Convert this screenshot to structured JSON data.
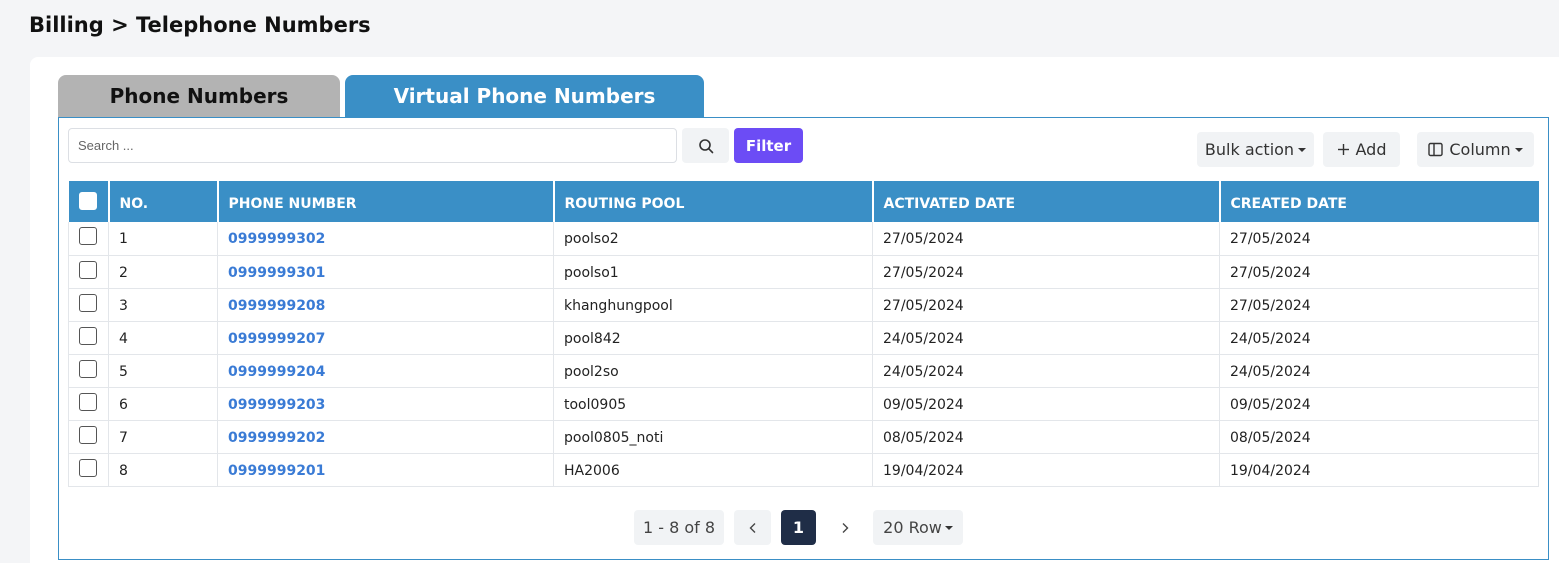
{
  "breadcrumb": "Billing > Telephone Numbers",
  "tabs": [
    {
      "label": "Phone Numbers",
      "active": false
    },
    {
      "label": "Virtual Phone Numbers",
      "active": true
    }
  ],
  "search": {
    "placeholder": "Search ...",
    "value": ""
  },
  "toolbar": {
    "filter_label": "Filter",
    "bulk_label": "Bulk action",
    "add_label": "Add",
    "column_label": "Column"
  },
  "table": {
    "headers": [
      "NO.",
      "PHONE NUMBER",
      "ROUTING POOL",
      "ACTIVATED DATE",
      "CREATED DATE"
    ],
    "rows": [
      {
        "no": "1",
        "phone": "0999999302",
        "pool": "poolso2",
        "activated": "27/05/2024",
        "created": "27/05/2024"
      },
      {
        "no": "2",
        "phone": "0999999301",
        "pool": "poolso1",
        "activated": "27/05/2024",
        "created": "27/05/2024"
      },
      {
        "no": "3",
        "phone": "0999999208",
        "pool": "khanghungpool",
        "activated": "27/05/2024",
        "created": "27/05/2024"
      },
      {
        "no": "4",
        "phone": "0999999207",
        "pool": "pool842",
        "activated": "24/05/2024",
        "created": "24/05/2024"
      },
      {
        "no": "5",
        "phone": "0999999204",
        "pool": "pool2so",
        "activated": "24/05/2024",
        "created": "24/05/2024"
      },
      {
        "no": "6",
        "phone": "0999999203",
        "pool": "tool0905",
        "activated": "09/05/2024",
        "created": "09/05/2024"
      },
      {
        "no": "7",
        "phone": "0999999202",
        "pool": "pool0805_noti",
        "activated": "08/05/2024",
        "created": "08/05/2024"
      },
      {
        "no": "8",
        "phone": "0999999201",
        "pool": "HA2006",
        "activated": "19/04/2024",
        "created": "19/04/2024"
      }
    ]
  },
  "pagination": {
    "range": "1 - 8 of 8",
    "current_page": "1",
    "rows_label": "20 Row"
  },
  "icons": {
    "search": "search-icon",
    "add": "plus-icon",
    "column": "columns-icon",
    "prev": "chevron-left-icon",
    "next": "chevron-right-icon"
  },
  "colors": {
    "accent": "#3a8fc6",
    "filter": "#6c4cf5",
    "link": "#3a7bd5",
    "pager_active": "#1f2d47"
  }
}
